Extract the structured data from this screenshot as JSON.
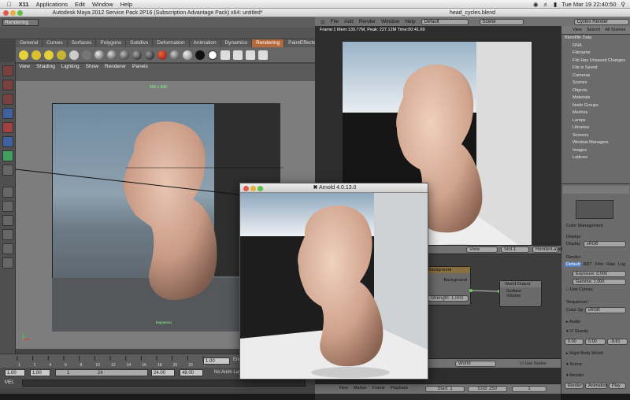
{
  "menubar": {
    "items": [
      "X11",
      "Applications",
      "Edit",
      "Window",
      "Help"
    ],
    "clock": "Tue Mar 19  22:40:50"
  },
  "maya": {
    "title": "Autodesk Maya 2012 Service Pack 2P16 (Subscription Advantage Pack) x64: untitled*",
    "mode": "Rendering",
    "shelf_tabs": [
      "General",
      "Curves",
      "Surfaces",
      "Polygons",
      "Subdivs",
      "Deformation",
      "Animation",
      "Dynamics",
      "Rendering",
      "PaintEffects"
    ],
    "active_shelf_tab": "Rendering",
    "viewport_menu": [
      "View",
      "Shading",
      "Lighting",
      "Show",
      "Renderer",
      "Panels"
    ],
    "resolution_label": "500 x 500",
    "camera_label": "Ewpasmq",
    "timeline": {
      "ticks": [
        "1",
        "2",
        "4",
        "6",
        "8",
        "10",
        "12",
        "14",
        "16",
        "18",
        "20",
        "22",
        "24"
      ],
      "current_frame": "1.00",
      "end_field": "End"
    },
    "range": {
      "start": "1.00",
      "start2": "1.00",
      "marker": "1",
      "end_marker": "24",
      "end": "24.00",
      "max": "48.00",
      "anim_layer": "No Anim Layer"
    },
    "command_label": "MEL"
  },
  "arnold": {
    "title": "Arnold 4.0.13.0"
  },
  "blender": {
    "title": "head_cycles.blend",
    "header": {
      "menus": [
        "File",
        "Add",
        "Render",
        "Window",
        "Help"
      ],
      "layout": "Default",
      "scene": "Scene",
      "engine": "Cycles Render"
    },
    "stats": "Frame:1 Mem:139.77M, Peak: 227.12M Time:00:41.69",
    "outliner": {
      "menus": [
        "View",
        "Search",
        "All Scenes"
      ],
      "items": [
        "Blendfile Data",
        "RNA",
        "Filename",
        "File Has Unsaved Changes",
        "File is Saved",
        "Cameras",
        "Scenes",
        "Objects",
        "Materials",
        "Node Groups",
        "Meshes",
        "Lamps",
        "Libraries",
        "Screens",
        "Window Managers",
        "Images",
        "Lattices"
      ]
    },
    "properties": {
      "color_management": "Color Management",
      "display_label": "Display:",
      "display_select": "Display",
      "display_value": "sRGB",
      "render_label": "Render:",
      "tabs": [
        "Default",
        "RRT",
        "Film",
        "Raw",
        "Log"
      ],
      "exposure_label": "Exposure",
      "exposure_value": "0.000",
      "gamma_label": "Gamma",
      "gamma_value": "1.000",
      "use_curves": "Use Curves",
      "sequencer": "Sequencer:",
      "color_space_label": "Color Sp",
      "color_space_value": "sRGB",
      "audio": "Audio",
      "gravity": "Gravity",
      "gravity_x": "0.00",
      "gravity_y": "0.00",
      "gravity_z": "-9.81",
      "rigid_body_world": "Rigid Body World",
      "scene_section": "Scene",
      "render_section": "Render",
      "render_button": "Render",
      "animation_button": "Animation",
      "play_button": "Play"
    },
    "node_editor": {
      "menus": [
        "View",
        "Select",
        "Add",
        "Node"
      ],
      "view": "View",
      "slot": "Slot 1",
      "render_layer": "RenderLayer",
      "background_node": "Background",
      "background_output": "Background",
      "strength_label": "Strength",
      "strength_value": "1.000",
      "world_output_node": "World Output",
      "surface_socket": "Surface",
      "volume_socket": "Volume",
      "world_field": "World",
      "use_nodes": "Use Nodes"
    },
    "timeline": {
      "menus": [
        "View",
        "Marker",
        "Frame",
        "Playback"
      ],
      "start": "Start: 1",
      "end": "End: 250",
      "current": "1"
    }
  }
}
